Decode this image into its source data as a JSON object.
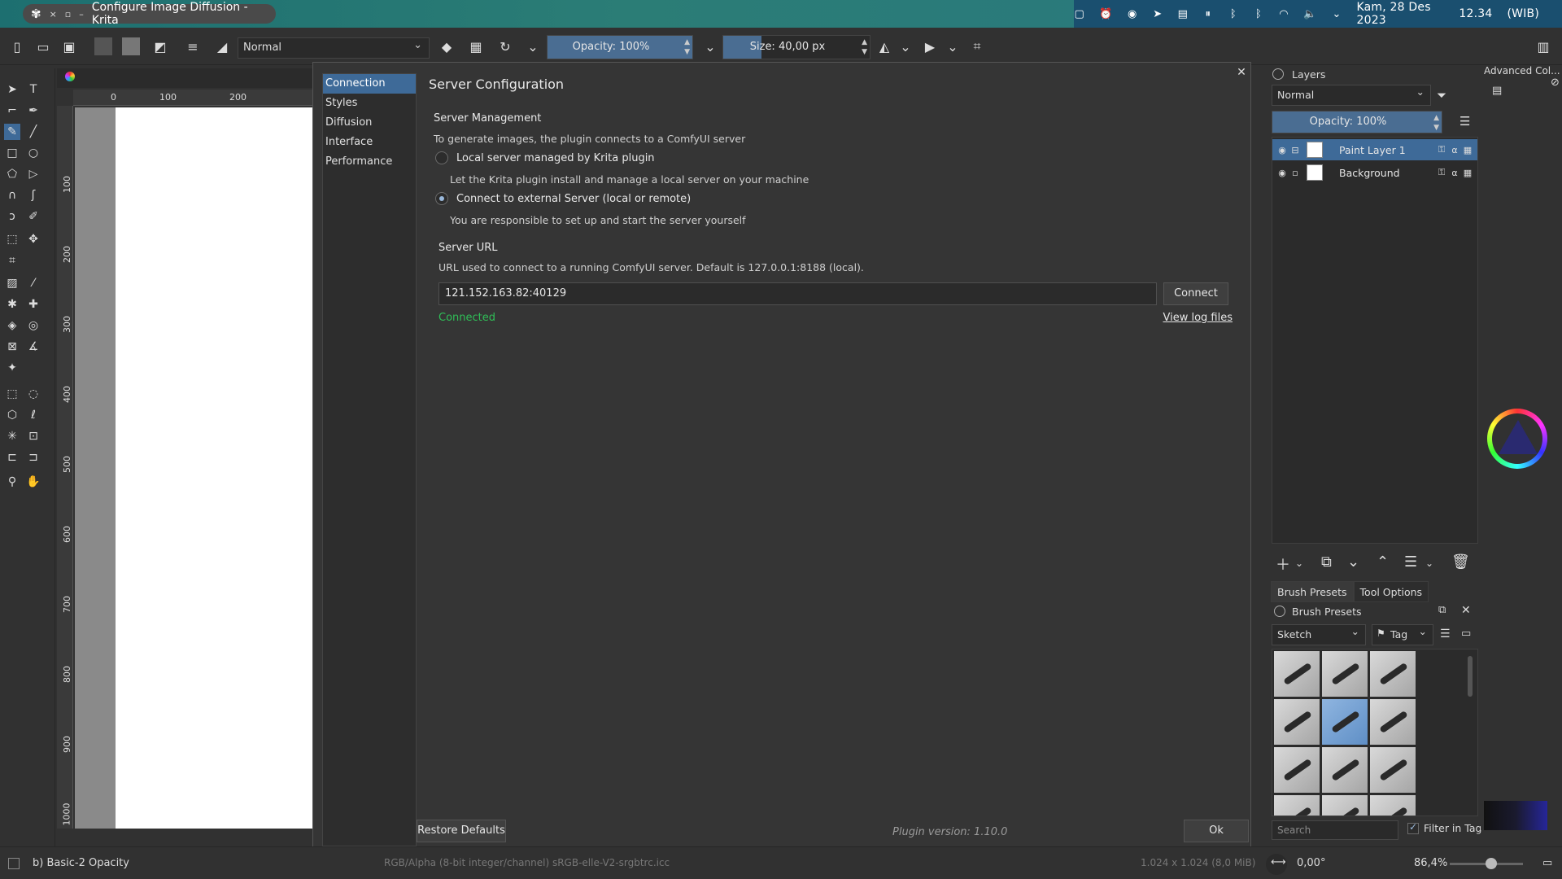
{
  "window": {
    "title": "Configure Image Diffusion - Krita",
    "controls": [
      "×",
      "▫",
      "–"
    ]
  },
  "tray": {
    "date": "Kam, 28 Des 2023",
    "time": "12.34",
    "timezone": "(WIB)"
  },
  "toolbar": {
    "blend_mode": "Normal",
    "opacity_label": "Opacity: 100%",
    "opacity_value": 100,
    "size_label": "Size: 40,00 px"
  },
  "ruler": {
    "h_ticks": [
      "0",
      "100",
      "200"
    ],
    "v_ticks": [
      "100",
      "200",
      "300",
      "400",
      "500",
      "600",
      "700",
      "800",
      "900",
      "1000"
    ]
  },
  "dialog": {
    "nav": [
      "Connection",
      "Styles",
      "Diffusion",
      "Interface",
      "Performance"
    ],
    "title": "Server Configuration",
    "server_management": {
      "heading": "Server Management",
      "description": "To generate images, the plugin connects to a ComfyUI server",
      "local_label": "Local server managed by Krita plugin",
      "local_desc": "Let the Krita plugin install and manage a local server on your machine",
      "external_label": "Connect to external Server (local or remote)",
      "external_desc": "You are responsible to set up and start the server yourself",
      "selected": "external"
    },
    "server_url": {
      "heading": "Server URL",
      "description": "URL used to connect to a running ComfyUI server. Default is 127.0.0.1:8188 (local).",
      "value": "121.152.163.82:40129",
      "connect_label": "Connect",
      "status": "Connected",
      "view_log": "View log files"
    },
    "footer": {
      "restore_label": "Restore Defaults",
      "version": "Plugin version: 1.10.0",
      "ok_label": "Ok"
    }
  },
  "layers_panel": {
    "title": "Layers",
    "blend_mode": "Normal",
    "opacity_label": "Opacity:  100%",
    "layers": [
      {
        "name": "Paint Layer 1",
        "selected": true
      },
      {
        "name": "Background",
        "selected": false
      }
    ]
  },
  "color_panel": {
    "title": "Advanced Col..."
  },
  "brush_panel": {
    "tabs": [
      "Brush Presets",
      "Tool Options"
    ],
    "title": "Brush Presets",
    "category": "Sketch",
    "tag_label": "Tag",
    "search_placeholder": "Search",
    "filter_label": "Filter in Tag",
    "filter_checked": true
  },
  "statusbar": {
    "brush": "b) Basic-2 Opacity",
    "color_info": "RGB/Alpha (8-bit integer/channel)  sRGB-elle-V2-srgbtrc.icc",
    "dims": "1.024 x 1.024 (8,0 MiB)",
    "rotation": "0,00°",
    "zoom": "86,4%"
  },
  "colors": {
    "accent": "#3e6a98",
    "connected": "#2fbf57",
    "topbar": "#2a7a7b"
  }
}
